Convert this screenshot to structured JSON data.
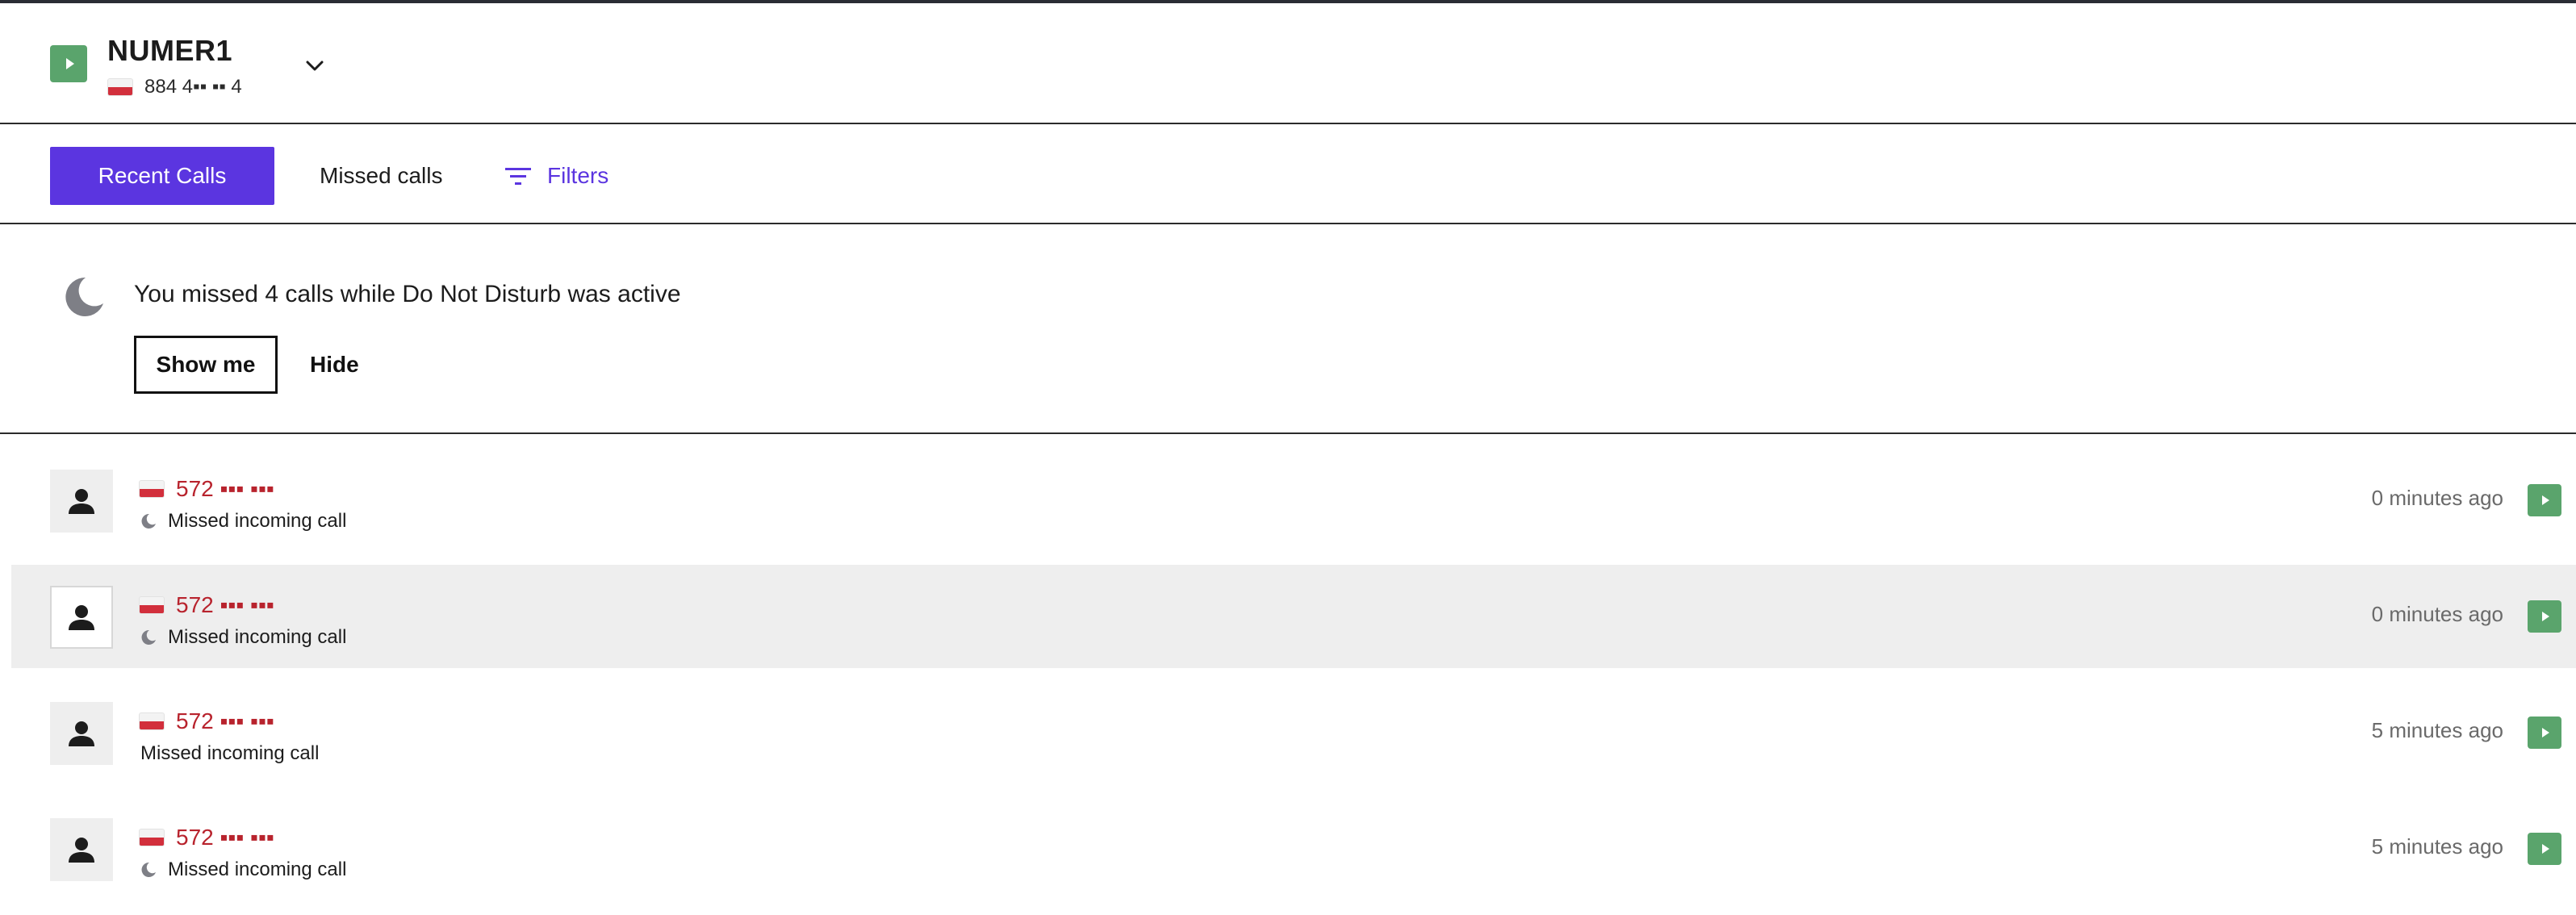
{
  "header": {
    "line_name": "NUMER1",
    "line_number": "884 4▪▪ ▪▪ 4",
    "icons": {
      "badge": "play-icon",
      "flag": "poland-flag-icon",
      "dropdown": "chevron-down-icon"
    }
  },
  "tabs": {
    "recent_label": "Recent Calls",
    "missed_label": "Missed calls",
    "filters_label": "Filters"
  },
  "notice": {
    "text": "You missed 4 calls while Do Not Disturb was active",
    "show_label": "Show me",
    "hide_label": "Hide"
  },
  "calls": [
    {
      "number": "572 ▪▪▪ ▪▪▪",
      "status": "Missed incoming call",
      "dnd": true,
      "time": "0 minutes ago"
    },
    {
      "number": "572 ▪▪▪ ▪▪▪",
      "status": "Missed incoming call",
      "dnd": true,
      "time": "0 minutes ago"
    },
    {
      "number": "572 ▪▪▪ ▪▪▪",
      "status": "Missed incoming call",
      "dnd": false,
      "time": "5 minutes ago"
    },
    {
      "number": "572 ▪▪▪ ▪▪▪",
      "status": "Missed incoming call",
      "dnd": true,
      "time": "5 minutes ago"
    }
  ],
  "colors": {
    "accent": "#5b35e0",
    "play_green": "#5aa46c",
    "missed_red": "#b8232d",
    "selected_row": "#eeeeee"
  }
}
